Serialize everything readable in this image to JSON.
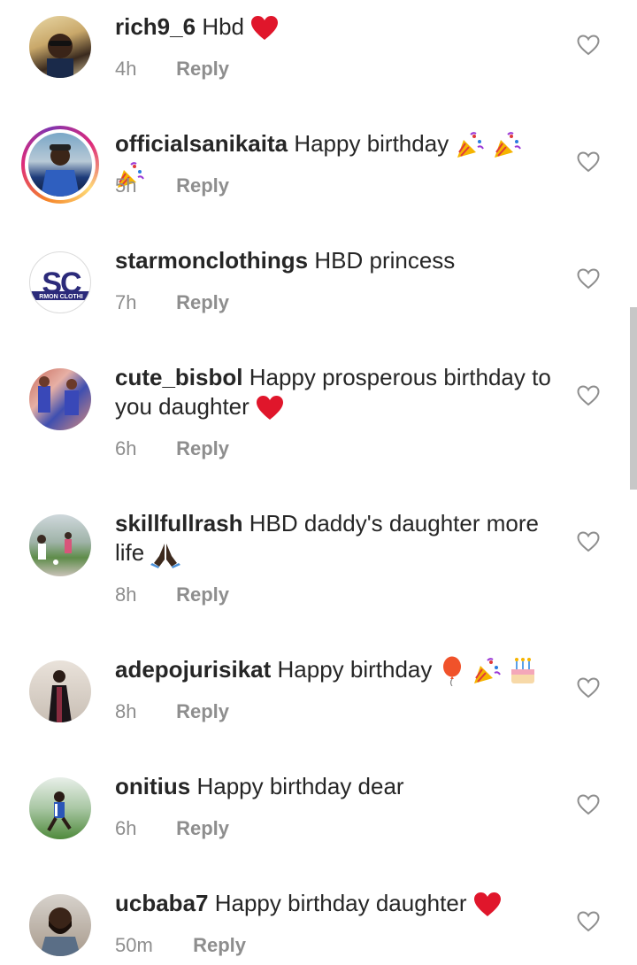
{
  "comments": [
    {
      "username": "rich9_6",
      "text": "Hbd",
      "emojis": [
        "red-heart"
      ],
      "time": "4h",
      "reply": "Reply"
    },
    {
      "username": "officialsanikaita",
      "text": "Happy birthday",
      "emojis": [
        "party-popper",
        "party-popper",
        "party-popper"
      ],
      "time": "5h",
      "reply": "Reply",
      "story_ring": true
    },
    {
      "username": "starmonclothings",
      "text": "HBD princess",
      "emojis": [],
      "time": "7h",
      "reply": "Reply",
      "avatar_logo": "SC",
      "avatar_caption": "RMON CLOTHI"
    },
    {
      "username": "cute_bisbol",
      "text": "Happy prosperous birthday to you daughter",
      "emojis": [
        "red-heart"
      ],
      "time": "6h",
      "reply": "Reply"
    },
    {
      "username": "skillfullrash",
      "text": "HBD daddy's daughter more life",
      "emojis": [
        "folded-hands"
      ],
      "time": "8h",
      "reply": "Reply"
    },
    {
      "username": "adepojurisikat",
      "text": "Happy birthday",
      "emojis": [
        "balloon",
        "party-popper",
        "birthday-cake"
      ],
      "time": "8h",
      "reply": "Reply"
    },
    {
      "username": "onitius",
      "text": "Happy birthday dear",
      "emojis": [],
      "time": "6h",
      "reply": "Reply"
    },
    {
      "username": "ucbaba7",
      "text": "Happy birthday daughter",
      "emojis": [
        "red-heart"
      ],
      "time": "50m",
      "reply": "Reply"
    }
  ],
  "colors": {
    "text": "#262626",
    "meta": "#8e8e8e",
    "heart_emoji": "#e0162b",
    "logo": "#2b2a7a"
  }
}
